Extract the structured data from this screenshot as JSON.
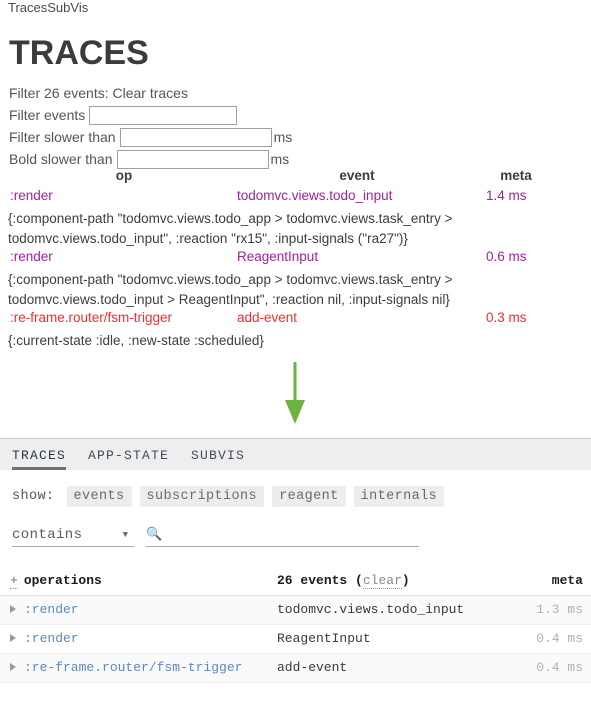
{
  "widget": {
    "title": "TracesSubVis"
  },
  "traces_panel": {
    "heading": "TRACES",
    "filter_summary_prefix": "Filter 26 events:",
    "clear_link": "Clear traces",
    "filter_events_label": "Filter events",
    "filter_events_value": "",
    "filter_slower_label": "Filter slower than",
    "filter_slower_value": "",
    "bold_slower_label": "Bold slower than",
    "bold_slower_value": "",
    "ms_unit": "ms",
    "columns": {
      "op": "op",
      "event": "event",
      "meta": "meta"
    },
    "rows": [
      {
        "op": ":render",
        "event": "todomvc.views.todo_input",
        "meta": "1.4 ms",
        "kind": "render",
        "detail": "{:component-path \"todomvc.views.todo_app > todomvc.views.task_entry > todomvc.views.todo_input\", :reaction \"rx15\", :input-signals (\"ra27\")}"
      },
      {
        "op": ":render",
        "event": "ReagentInput",
        "meta": "0.6 ms",
        "kind": "render",
        "detail": "{:component-path \"todomvc.views.todo_app > todomvc.views.task_entry > todomvc.views.todo_input > ReagentInput\", :reaction nil, :input-signals nil}"
      },
      {
        "op": ":re-frame.router/fsm-trigger",
        "event": "add-event",
        "meta": "0.3 ms",
        "kind": "event",
        "detail": "{:current-state :idle, :new-state :scheduled}"
      }
    ]
  },
  "arrow": {
    "icon": "arrow-down-icon",
    "color": "#6db33f"
  },
  "devtools": {
    "tabs": [
      {
        "label": "TRACES",
        "active": true
      },
      {
        "label": "APP-STATE",
        "active": false
      },
      {
        "label": "SUBVIS",
        "active": false
      }
    ],
    "show_label": "show:",
    "show_chips": [
      "events",
      "subscriptions",
      "reagent",
      "internals"
    ],
    "match_mode": "contains",
    "search_icon": "search-icon",
    "search_value": "",
    "search_placeholder": "",
    "table": {
      "plus": "+",
      "operations_header": "operations",
      "events_count": "26",
      "events_word": "events",
      "clear_label": "clear",
      "meta_header": "meta",
      "rows": [
        {
          "op": ":render",
          "event": "todomvc.views.todo_input",
          "meta": "1.3 ms"
        },
        {
          "op": ":render",
          "event": "ReagentInput",
          "meta": "0.4 ms"
        },
        {
          "op": ":re-frame.router/fsm-trigger",
          "event": "add-event",
          "meta": "0.4 ms"
        }
      ]
    }
  }
}
